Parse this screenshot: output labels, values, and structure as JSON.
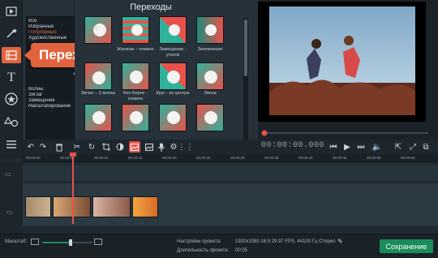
{
  "callout": {
    "label": "Переходы"
  },
  "gallery": {
    "title": "Переходы"
  },
  "categories": [
    "Все",
    "Избранные",
    "Популярные",
    "Художественные",
    "",
    "",
    "",
    "",
    "",
    "",
    "",
    "",
    "",
    "Волны",
    "Зигзаг",
    "Замещение",
    "Масштабирование"
  ],
  "selected_category": "Популярные",
  "thumbnails_row1_captions": [
    "",
    "",
    "",
    ""
  ],
  "thumbnails_row2_captions": [
    "",
    "Жалюзи – плавно",
    "Замещение - уголок",
    "Затемнение"
  ],
  "thumbnails_row3_captions": [
    "Зигзаг – 2 волны",
    "Кен Бернс - плавно",
    "Круг - из центра",
    "Линза"
  ],
  "timecode": "00:00:00.000",
  "ruler_ticks": [
    "00:00:00",
    "00:00:05",
    "00:00:10",
    "00:00:15",
    "00:00:20",
    "00:00:25",
    "00:00:30",
    "00:00:35",
    "00:00:40",
    "00:00:45",
    "00:00:50",
    "00:00:55"
  ],
  "bottom": {
    "scale_label": "Масштаб:",
    "settings_label": "Настройки проекта:",
    "settings_value": "1920x1080 16:9 29.97 FPS, 44100 Гц Стерео",
    "duration_label": "Длительность проекта:",
    "duration_value": "00:05",
    "save_label": "Сохранение"
  },
  "colors": {
    "accent": "#e2643f",
    "save": "#1a8b5b"
  }
}
